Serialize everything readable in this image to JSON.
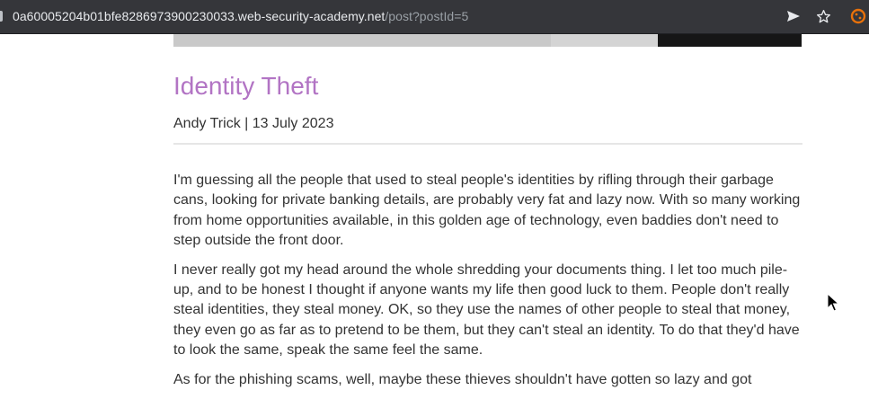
{
  "browser": {
    "url_host": "0a60005204b01bfe8286973900230033.web-security-academy.net",
    "url_path": "/post?postId=5",
    "icons": [
      "send-icon",
      "bookmark-star-icon",
      "extension-icon"
    ]
  },
  "post": {
    "title": "Identity Theft",
    "byline": "Andy Trick | 13 July 2023",
    "paragraphs": [
      "I'm guessing all the people that used to steal people's identities by rifling through their garbage cans, looking for private banking details, are probably very fat and lazy now. With so many working from home opportunities available, in this golden age of technology, even baddies don't need to step outside the front door.",
      "I never really got my head around the whole shredding your documents thing. I let too much pile-up, and to be honest I thought if anyone wants my life then good luck to them. People don't really steal identities, they steal money. OK, so they use the names of other people to steal that money, they even go as far as to pretend to be them, but they can't steal an identity. To do that they'd have to look the same, speak the same feel the same.",
      "As for the phishing scams, well, maybe these thieves shouldn't have gotten so lazy and got"
    ]
  },
  "colors": {
    "title": "#b274c4",
    "text": "#333333",
    "toolbar": "#35363a"
  }
}
